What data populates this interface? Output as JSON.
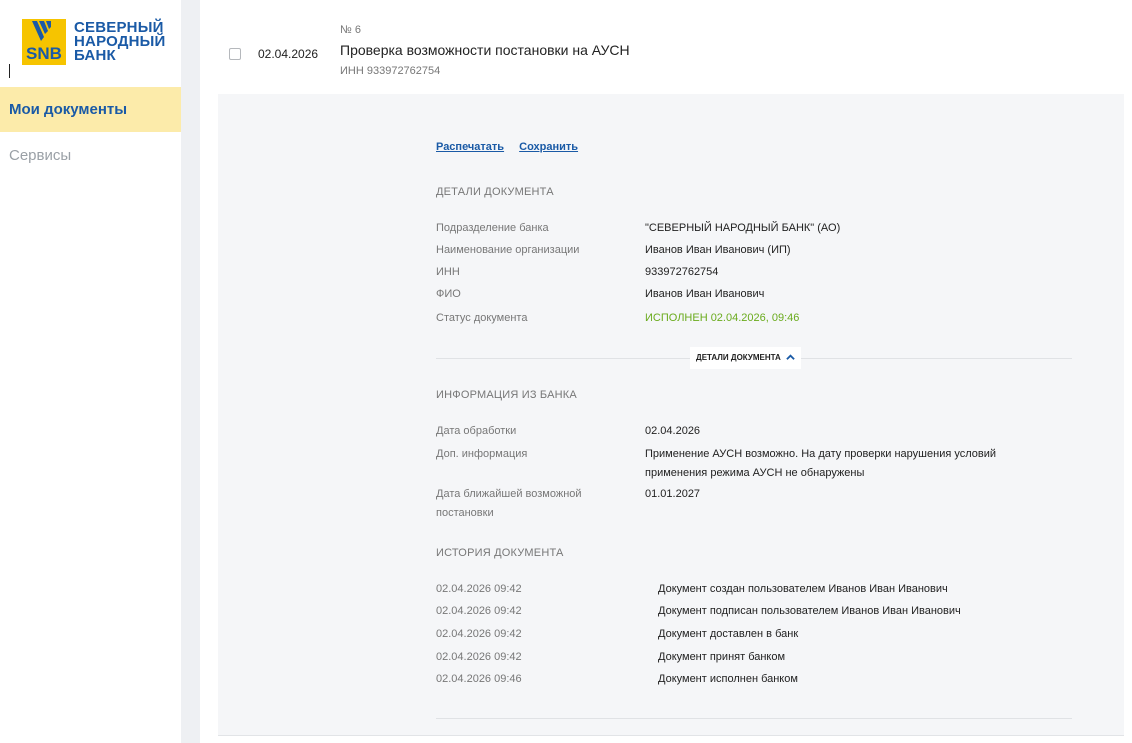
{
  "bank": {
    "logo_abbr": "SNB",
    "logo_line1": "СЕВЕРНЫЙ",
    "logo_line2": "НАРОДНЫЙ",
    "logo_line3": "БАНК"
  },
  "sidebar": {
    "items": [
      {
        "label": "Мои документы"
      },
      {
        "label": "Сервисы"
      }
    ]
  },
  "document": {
    "date": "02.04.2026",
    "number": "№ 6",
    "title": "Проверка возможности постановки на АУСН",
    "inn": "ИНН 933972762754"
  },
  "actions": {
    "print_label": "Распечатать",
    "save_label": "Сохранить"
  },
  "details": {
    "section_title": "ДЕТАЛИ ДОКУМЕНТА",
    "rows": [
      {
        "label": "Подразделение банка",
        "value": "\"СЕВЕРНЫЙ НАРОДНЫЙ БАНК\" (АО)"
      },
      {
        "label": "Наименование организации",
        "value": "Иванов Иван Иванович (ИП)"
      },
      {
        "label": "ИНН",
        "value": "933972762754"
      },
      {
        "label": "ФИО",
        "value": "Иванов Иван Иванович"
      },
      {
        "label": "Статус документа",
        "value": "ИСПОЛНЕН 02.04.2026, 09:46"
      }
    ],
    "toggle_label": "ДЕТАЛИ ДОКУМЕНТА"
  },
  "bank_info": {
    "section_title": "ИНФОРМАЦИЯ ИЗ БАНКА",
    "rows": [
      {
        "label": "Дата обработки",
        "value": "02.04.2026"
      },
      {
        "label": "Доп. информация",
        "value": "Применение АУСН возможно. На дату проверки нарушения условий применения режима АУСН не обнаружены"
      },
      {
        "label": "Дата ближайшей возможной постановки",
        "value": "01.01.2027"
      }
    ]
  },
  "history": {
    "section_title": "ИСТОРИЯ ДОКУМЕНТА",
    "rows": [
      {
        "time": "02.04.2026 09:42",
        "event": "Документ создан пользователем Иванов Иван Иванович"
      },
      {
        "time": "02.04.2026 09:42",
        "event": "Документ подписан пользователем Иванов Иван Иванович"
      },
      {
        "time": "02.04.2026 09:42",
        "event": "Документ доставлен в банк"
      },
      {
        "time": "02.04.2026 09:42",
        "event": "Документ принят банком"
      },
      {
        "time": "02.04.2026 09:46",
        "event": "Документ исполнен банком"
      }
    ]
  },
  "colors": {
    "brand_blue": "#1a5aa6",
    "brand_yellow": "#f6c400",
    "active_nav_bg": "#fcebaa",
    "status_green": "#6aab1d"
  }
}
